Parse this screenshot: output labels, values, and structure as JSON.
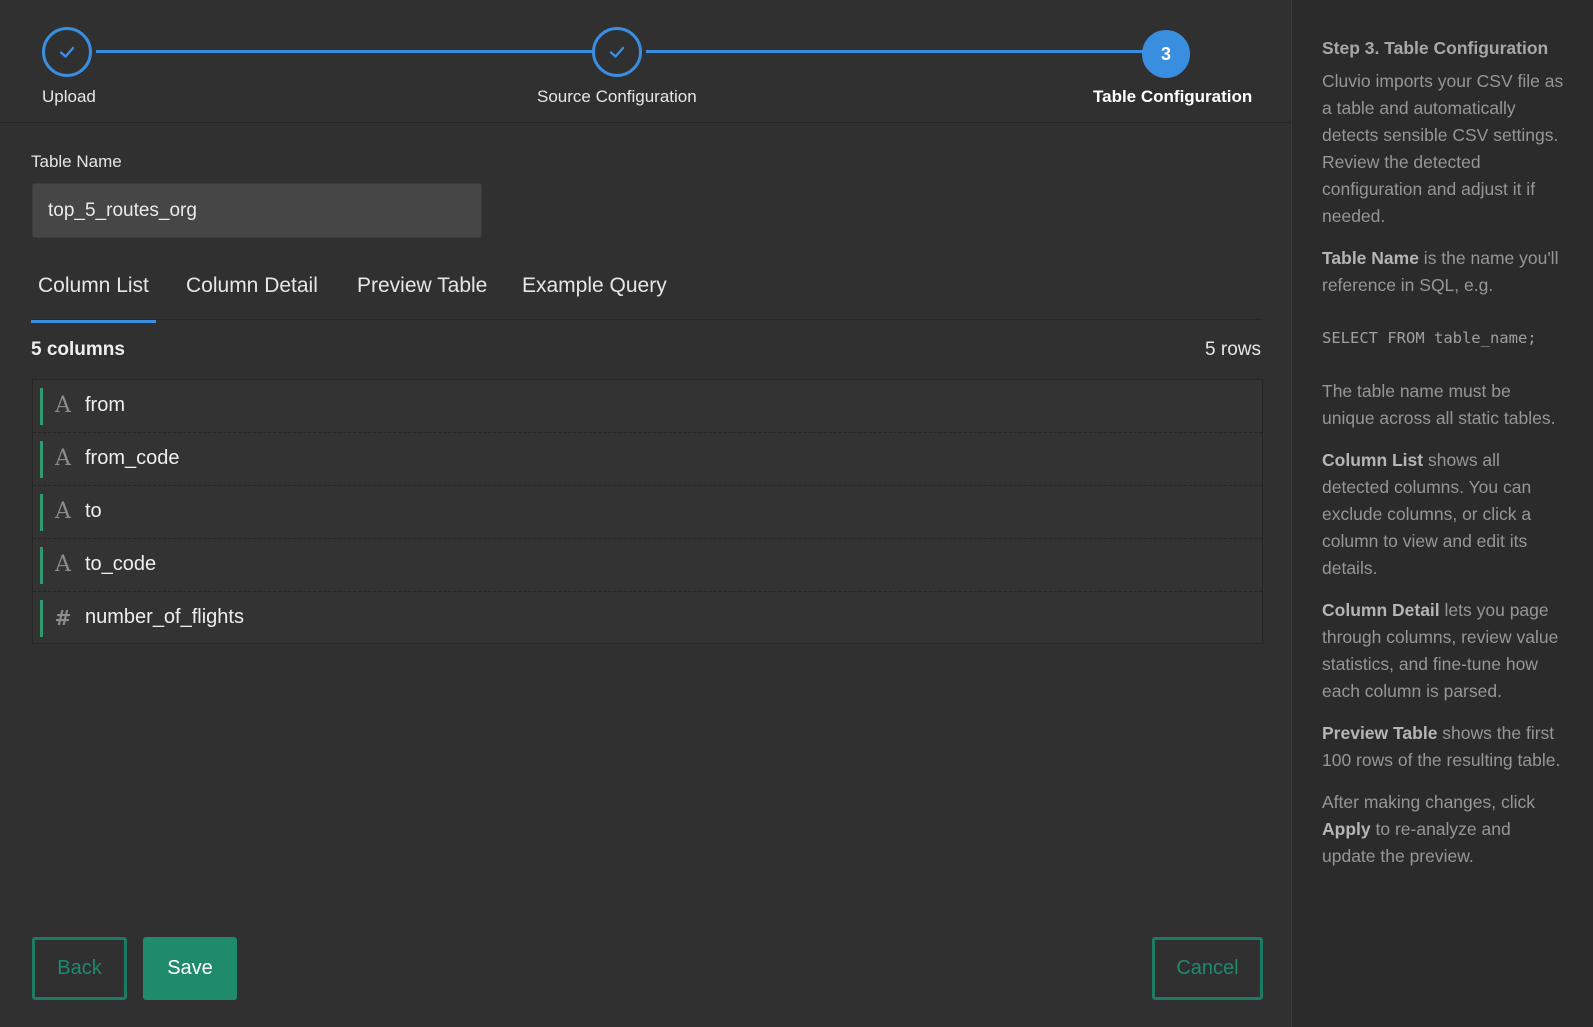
{
  "stepper": {
    "steps": [
      {
        "label": "Upload",
        "state": "done"
      },
      {
        "label": "Source Configuration",
        "state": "done"
      },
      {
        "label": "Table Configuration",
        "state": "active",
        "number": "3"
      }
    ],
    "accent_color": "#3a8ee0"
  },
  "form": {
    "table_name_label": "Table Name",
    "table_name_value": "top_5_routes_org"
  },
  "tabs": [
    {
      "label": "Column List",
      "active": true
    },
    {
      "label": "Column Detail",
      "active": false
    },
    {
      "label": "Preview Table",
      "active": false
    },
    {
      "label": "Example Query",
      "active": false
    }
  ],
  "summary": {
    "columns_count": "5 columns",
    "rows_count": "5 rows"
  },
  "columns": [
    {
      "name": "from",
      "type_icon": "text-type-icon",
      "glyph": "A"
    },
    {
      "name": "from_code",
      "type_icon": "text-type-icon",
      "glyph": "A"
    },
    {
      "name": "to",
      "type_icon": "text-type-icon",
      "glyph": "A"
    },
    {
      "name": "to_code",
      "type_icon": "text-type-icon",
      "glyph": "A"
    },
    {
      "name": "number_of_flights",
      "type_icon": "number-type-icon",
      "glyph": "#"
    }
  ],
  "buttons": {
    "back": "Back",
    "save": "Save",
    "cancel": "Cancel",
    "primary_color": "#1f8a6c"
  },
  "help": {
    "title": "Step 3. Table Configuration",
    "intro": "Cluvio imports your CSV file as a table and automatically detects sensible CSV settings. Review the detected configuration and adjust it if needed.",
    "table_name_term": "Table Name",
    "table_name_text": " is the name you'll reference in SQL, e.g.",
    "sql_example": "SELECT FROM table_name;",
    "unique_text": "The table name must be unique across all static tables.",
    "column_list_term": "Column List",
    "column_list_text": " shows all detected columns. You can exclude columns, or click a column to view and edit its details.",
    "column_detail_term": "Column Detail",
    "column_detail_text": " lets you page through columns, review value statistics, and fine-tune how each column is parsed.",
    "preview_table_term": "Preview Table",
    "preview_table_text": " shows the first 100 rows of the resulting table.",
    "apply_pre": "After making changes, click ",
    "apply_term": "Apply",
    "apply_post": " to re-analyze and update the preview."
  }
}
